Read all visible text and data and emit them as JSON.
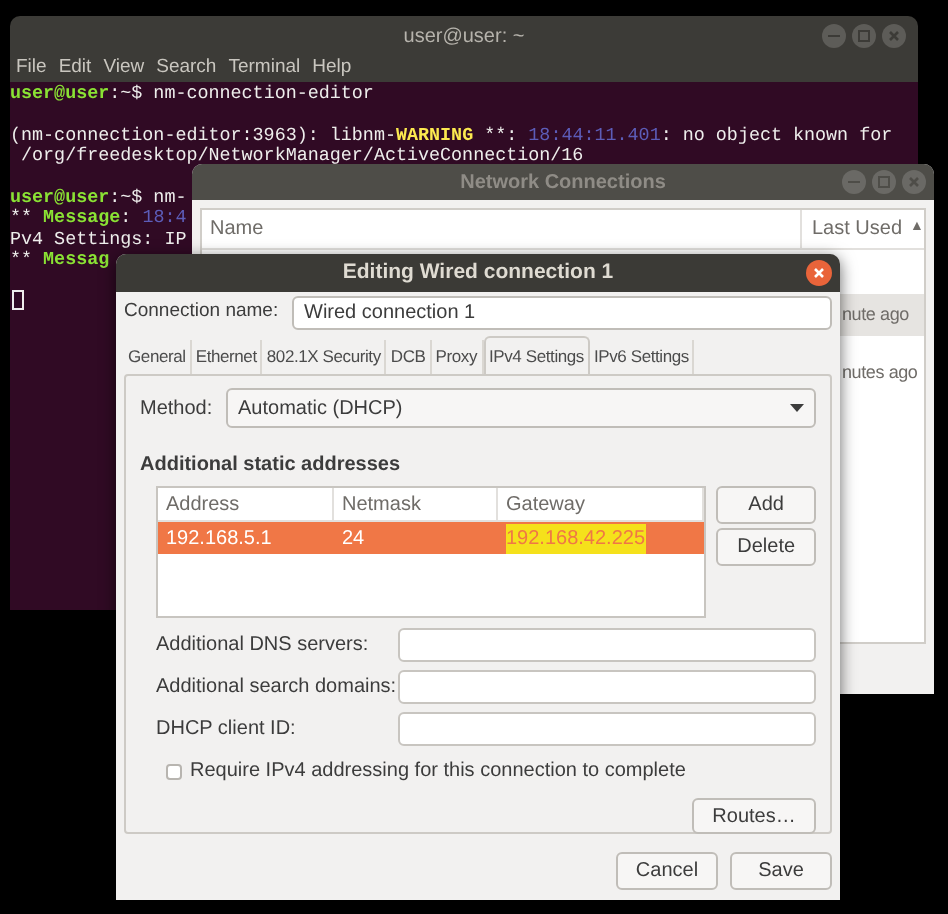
{
  "terminal": {
    "title": "user@user: ~",
    "menu": [
      "File",
      "Edit",
      "View",
      "Search",
      "Terminal",
      "Help"
    ],
    "blocks": [
      [
        {
          "segments": [
            {
              "kind": "prompt",
              "text": "user@user"
            },
            {
              "kind": "plain",
              "text": ":~$ nm-connection-editor"
            }
          ]
        }
      ],
      [
        {
          "segments": [
            {
              "kind": "plain",
              "text": "(nm-connection-editor:3963): libnm-"
            },
            {
              "kind": "warning",
              "text": "WARNING"
            },
            {
              "kind": "plain",
              "text": " **: "
            },
            {
              "kind": "time",
              "text": "18:44:11.401"
            },
            {
              "kind": "plain",
              "text": ": no object known for"
            }
          ]
        },
        {
          "segments": [
            {
              "kind": "plain",
              "text": " /org/freedesktop/NetworkManager/ActiveConnection/16"
            }
          ]
        }
      ],
      [
        {
          "segments": [
            {
              "kind": "prompt",
              "text": "user@user"
            },
            {
              "kind": "plain",
              "text": ":~$ nm-"
            }
          ]
        },
        {
          "segments": [
            {
              "kind": "plain",
              "text": "** "
            },
            {
              "kind": "message",
              "text": "Message"
            },
            {
              "kind": "plain",
              "text": ": "
            },
            {
              "kind": "time",
              "text": "18:4"
            }
          ]
        },
        {
          "segments": [
            {
              "kind": "plain",
              "text": "Pv4 Settings: IP"
            }
          ]
        },
        {
          "segments": [
            {
              "kind": "plain",
              "text": "** "
            },
            {
              "kind": "message",
              "text": "Messag"
            }
          ]
        }
      ]
    ]
  },
  "network_connections": {
    "title": "Network Connections",
    "columns": [
      "Name",
      "Last Used"
    ],
    "sort_indicator": "▲",
    "rows": [
      {
        "last_used": "nute ago",
        "selected": true
      },
      {
        "last_used": "nutes ago",
        "selected": false
      }
    ]
  },
  "editor": {
    "title": "Editing Wired connection 1",
    "connection_name_label": "Connection name:",
    "connection_name": "Wired connection 1",
    "tabs": [
      {
        "label": "General",
        "selected": false
      },
      {
        "label": "Ethernet",
        "selected": false
      },
      {
        "label": "802.1X Security",
        "selected": false
      },
      {
        "label": "DCB",
        "selected": false
      },
      {
        "label": "Proxy",
        "selected": false
      },
      {
        "label": "IPv4 Settings",
        "selected": true
      },
      {
        "label": "IPv6 Settings",
        "selected": false
      }
    ],
    "method_label": "Method:",
    "method": "Automatic (DHCP)",
    "addresses_heading": "Additional static addresses",
    "address_columns": [
      "Address",
      "Netmask",
      "Gateway"
    ],
    "address_rows": [
      {
        "selected": true,
        "cells": [
          {
            "text": "192.168.5.1",
            "highlighted": false
          },
          {
            "text": "24",
            "highlighted": false
          },
          {
            "text": "192.168.42.225",
            "highlighted": true
          }
        ]
      }
    ],
    "address_buttons": [
      "Add",
      "Delete"
    ],
    "fields": [
      {
        "label": "Additional DNS servers:"
      },
      {
        "label": "Additional search domains:"
      },
      {
        "label": "DHCP client ID:"
      }
    ],
    "require_checkbox": {
      "label": "Require IPv4 addressing for this connection to complete",
      "checked": false
    },
    "routes_button": "Routes…",
    "buttons": [
      "Cancel",
      "Save"
    ]
  }
}
